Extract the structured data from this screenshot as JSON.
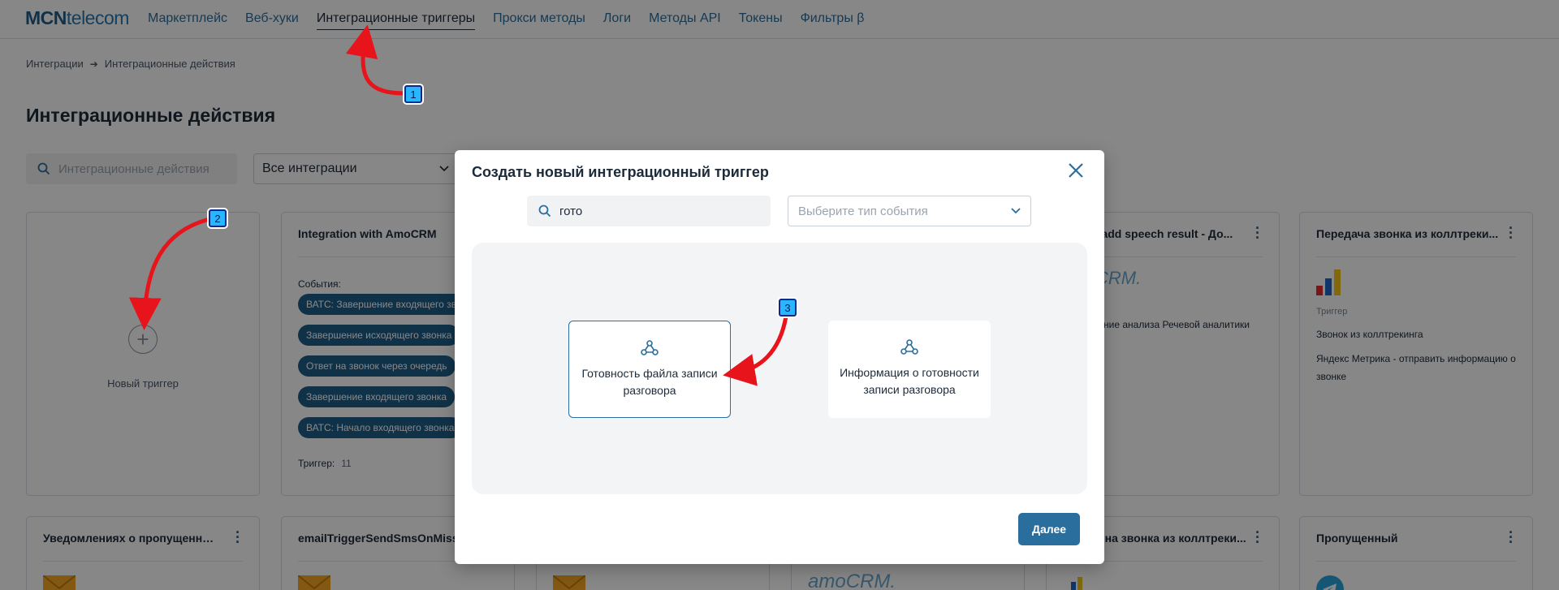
{
  "logo": {
    "bold": "MCN",
    "rest": "telecom"
  },
  "nav": {
    "items": [
      {
        "label": "Маркетплейс"
      },
      {
        "label": "Веб-хуки"
      },
      {
        "label": "Интеграционные триггеры",
        "active": true
      },
      {
        "label": "Прокси методы"
      },
      {
        "label": "Логи"
      },
      {
        "label": "Методы API"
      },
      {
        "label": "Токены"
      },
      {
        "label": "Фильтры β"
      }
    ]
  },
  "breadcrumb": {
    "root": "Интеграции",
    "current": "Интеграционные действия"
  },
  "page_title": "Интеграционные действия",
  "filters": {
    "search_placeholder": "Интеграционные действия",
    "select_value": "Все интеграции"
  },
  "cards": {
    "new_trigger": {
      "label": "Новый триггер"
    },
    "amo": {
      "title": "Integration with AmoCRM",
      "events_label": "События:",
      "events": [
        "ВАТС: Завершение входящего звонка",
        "Завершение исходящего звонка",
        "Ответ на звонок через очередь",
        "Завершение входящего звонка",
        "ВАТС: Начало входящего звонка"
      ],
      "trigger_label": "Триггер:",
      "trigger_count": "11"
    },
    "speech": {
      "title": "..., add speech result - До...",
      "logo_text": "CRM.",
      "text": "...ние анализа Речевой аналитики"
    },
    "calltracking": {
      "title": "Передача звонка из коллтреки...",
      "type_label": "Триггер",
      "line1": "Звонок из коллтрекинга",
      "line2": "Яндекс Метрика - отправить информацию о звонке"
    },
    "row2": [
      {
        "title": "Уведомлениях о пропущенных..."
      },
      {
        "title": "emailTriggerSendSmsOnMissed"
      },
      {
        "title": ""
      },
      {
        "title": "",
        "logo_text": "amoCRM."
      },
      {
        "title": "...на звонка из коллтреки..."
      },
      {
        "title": "Пропущенный"
      }
    ]
  },
  "modal": {
    "title": "Создать новый интеграционный триггер",
    "search_value": "гото",
    "event_type_placeholder": "Выберите тип события",
    "options": [
      {
        "label": "Готовность файла записи разговора",
        "selected": true
      },
      {
        "label": "Информация о готовности записи разговора",
        "selected": false
      }
    ],
    "next_button": "Далее"
  },
  "annotations": {
    "badge1": "1",
    "badge2": "2",
    "badge3": "3"
  },
  "colors": {
    "brand": "#1f5f8b",
    "accent": "#2a6e9d",
    "annotation_arrow": "#e8141c",
    "annotation_badge": "#29b6ff"
  }
}
